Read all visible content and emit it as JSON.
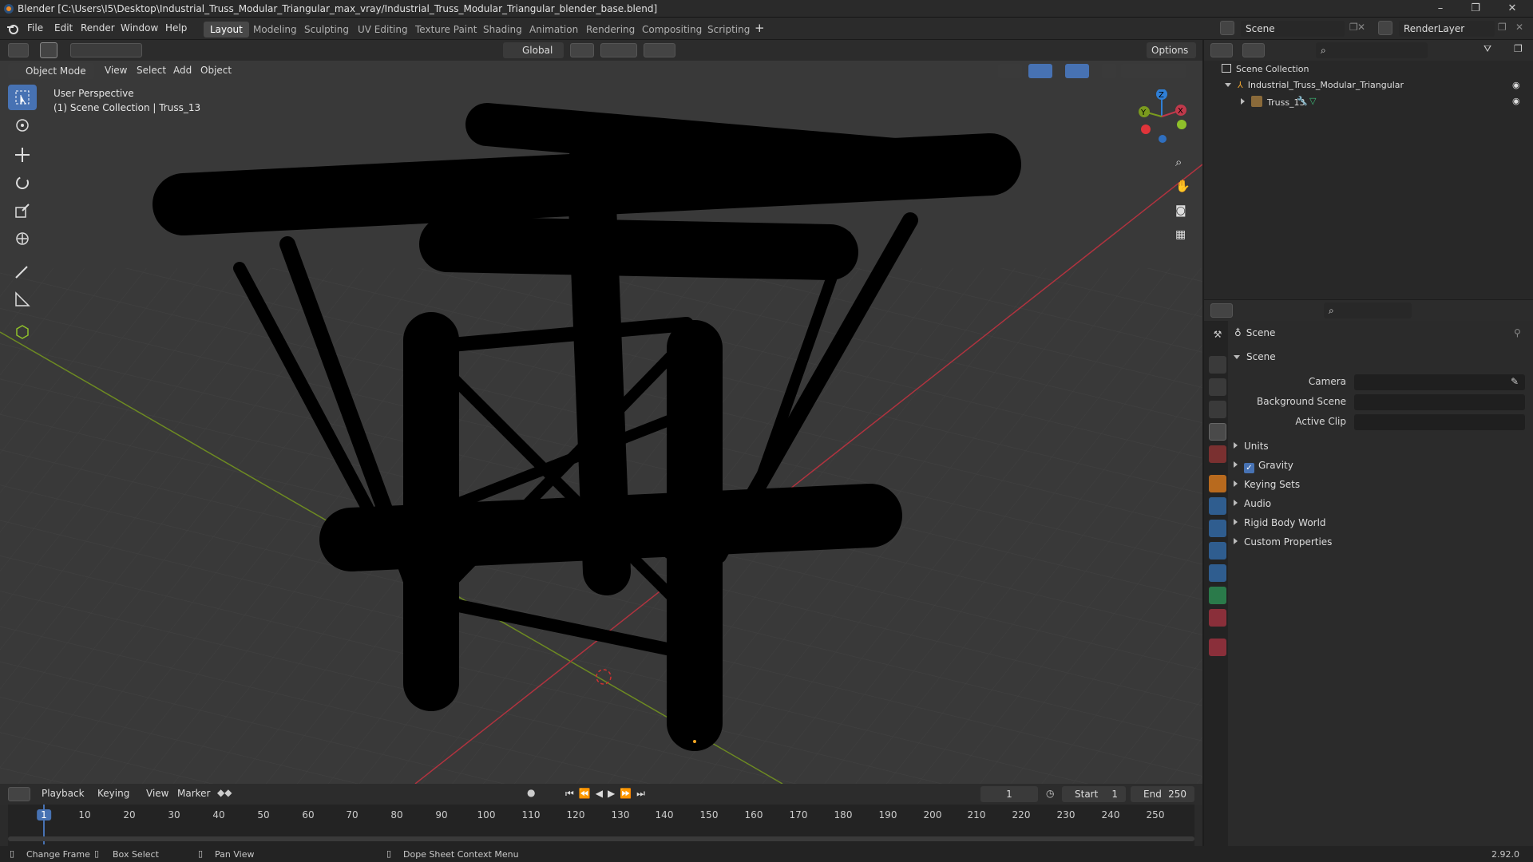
{
  "window": {
    "title": "Blender [C:\\Users\\I5\\Desktop\\Industrial_Truss_Modular_Triangular_max_vray/Industrial_Truss_Modular_Triangular_blender_base.blend]",
    "controls": [
      "–",
      "❐",
      "✕"
    ]
  },
  "menubar": {
    "menus": [
      "File",
      "Edit",
      "Render",
      "Window",
      "Help"
    ],
    "workspaces": [
      "Layout",
      "Modeling",
      "Sculpting",
      "UV Editing",
      "Texture Paint",
      "Shading",
      "Animation",
      "Rendering",
      "Compositing",
      "Scripting"
    ],
    "add_tab": "+",
    "scene_name": "Scene",
    "view_layer": "RenderLayer"
  },
  "viewport_header": {
    "transform_orientation": "Global",
    "options": "Options",
    "mode": "Object Mode",
    "menus": [
      "View",
      "Select",
      "Add",
      "Object"
    ]
  },
  "viewport": {
    "perspective": "User Perspective",
    "collection_info": "(1) Scene Collection | Truss_13",
    "gizmo_axes": [
      "X",
      "Y",
      "Z"
    ]
  },
  "outliner": {
    "search_placeholder": "",
    "root": "Scene Collection",
    "items": [
      {
        "label": "Industrial_Truss_Modular_Triangular"
      },
      {
        "label": "Truss_13"
      }
    ]
  },
  "properties": {
    "breadcrumb": "Scene",
    "panel": "Scene",
    "fields": [
      {
        "label": "Camera",
        "value": ""
      },
      {
        "label": "Background Scene",
        "value": ""
      },
      {
        "label": "Active Clip",
        "value": ""
      }
    ],
    "sections": [
      {
        "label": "Units",
        "checkbox": false
      },
      {
        "label": "Gravity",
        "checkbox": true
      },
      {
        "label": "Keying Sets",
        "checkbox": false
      },
      {
        "label": "Audio",
        "checkbox": false
      },
      {
        "label": "Rigid Body World",
        "checkbox": false
      },
      {
        "label": "Custom Properties",
        "checkbox": false
      }
    ]
  },
  "timeline": {
    "menus": [
      "Playback",
      "Keying",
      "View",
      "Marker"
    ],
    "current_frame": "1",
    "start_label": "Start",
    "start": "1",
    "end_label": "End",
    "end": "250",
    "ruler": [
      "1",
      "10",
      "20",
      "30",
      "40",
      "50",
      "60",
      "70",
      "80",
      "90",
      "100",
      "110",
      "120",
      "130",
      "140",
      "150",
      "160",
      "170",
      "180",
      "190",
      "200",
      "210",
      "220",
      "230",
      "240",
      "250"
    ]
  },
  "statusbar": {
    "hints": [
      "Change Frame",
      "Box Select",
      "Pan View",
      "Dope Sheet Context Menu"
    ],
    "version": "2.92.0"
  },
  "colors": {
    "accent": "#4772b3",
    "x_axis": "#c0394b",
    "y_axis": "#7a9a1e",
    "z_axis": "#2f7fd6"
  }
}
